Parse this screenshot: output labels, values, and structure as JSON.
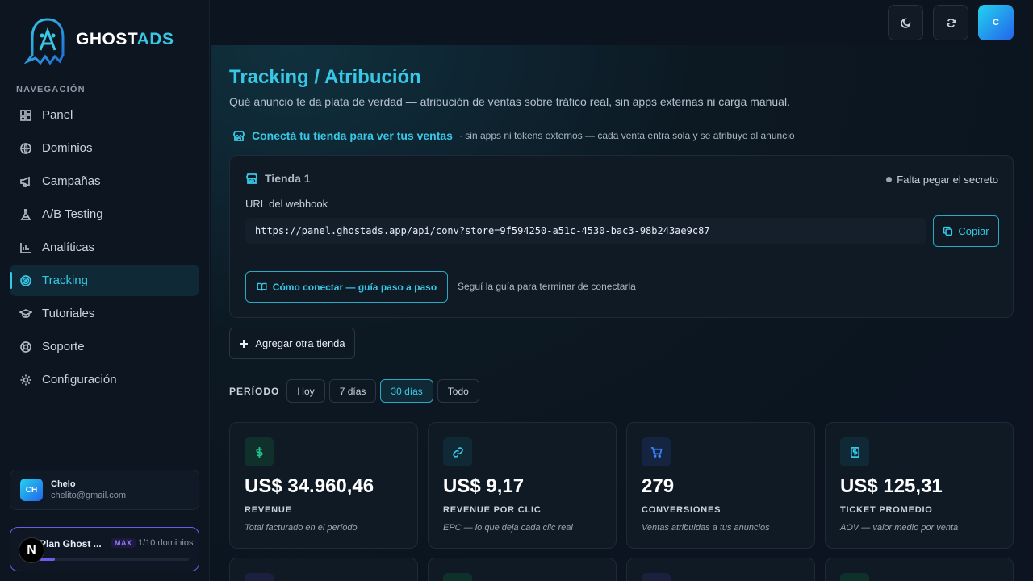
{
  "brand": {
    "name_part1": "GHOST",
    "name_part2": "ADS"
  },
  "sidebar": {
    "section_title": "NAVEGACIÓN",
    "items": [
      {
        "label": "Panel",
        "icon": "dashboard-icon"
      },
      {
        "label": "Dominios",
        "icon": "globe-icon"
      },
      {
        "label": "Campañas",
        "icon": "megaphone-icon"
      },
      {
        "label": "A/B Testing",
        "icon": "flask-icon"
      },
      {
        "label": "Analíticas",
        "icon": "bar-chart-icon"
      },
      {
        "label": "Tracking",
        "icon": "target-icon",
        "active": true
      },
      {
        "label": "Tutoriales",
        "icon": "graduation-cap-icon"
      },
      {
        "label": "Soporte",
        "icon": "lifebuoy-icon"
      },
      {
        "label": "Configuración",
        "icon": "gear-icon"
      }
    ],
    "user": {
      "initials": "CH",
      "name": "Chelo",
      "email": "chelito@gmail.com"
    },
    "plan": {
      "badge_letter": "N",
      "name": "Plan Ghost ...",
      "tier": "MAX",
      "domains": "1/10 dominios",
      "usage_fraction": 0.1
    }
  },
  "topbar": {
    "avatar_initial": "C"
  },
  "page": {
    "title": "Tracking / Atribución",
    "subtitle": "Qué anuncio te da plata de verdad — atribución de ventas sobre tráfico real, sin apps externas ni carga manual.",
    "connect_title": "Conectá tu tienda para ver tus ventas",
    "connect_note": "· sin apps ni tokens externos — cada venta entra sola y se atribuye al anuncio"
  },
  "store": {
    "name": "Tienda 1",
    "status": "Falta pegar el secreto",
    "webhook_label": "URL del webhook",
    "webhook_url": "https://panel.ghostads.app/api/conv?store=9f594250-a51c-4530-bac3-98b243ae9c87",
    "copy_label": "Copiar",
    "guide_label": "Cómo conectar — guía paso a paso",
    "guide_note": "Seguí la guía para terminar de conectarla"
  },
  "add_store_label": "Agregar otra tienda",
  "period": {
    "label": "PERÍODO",
    "options": [
      "Hoy",
      "7 días",
      "30 días",
      "Todo"
    ],
    "selected": "30 días"
  },
  "kpis": [
    {
      "value": "US$ 34.960,46",
      "label": "REVENUE",
      "desc": "Total facturado en el período",
      "icon": "dollar-icon",
      "color": "#22c58b"
    },
    {
      "value": "US$ 9,17",
      "label": "REVENUE POR CLIC",
      "desc": "EPC — lo que deja cada clic real",
      "icon": "link-icon",
      "color": "#38c8e6"
    },
    {
      "value": "279",
      "label": "CONVERSIONES",
      "desc": "Ventas atribuidas a tus anuncios",
      "icon": "cart-icon",
      "color": "#3b82f6"
    },
    {
      "value": "US$ 125,31",
      "label": "TICKET PROMEDIO",
      "desc": "AOV — valor medio por venta",
      "icon": "receipt-icon",
      "color": "#38c8e6"
    }
  ]
}
